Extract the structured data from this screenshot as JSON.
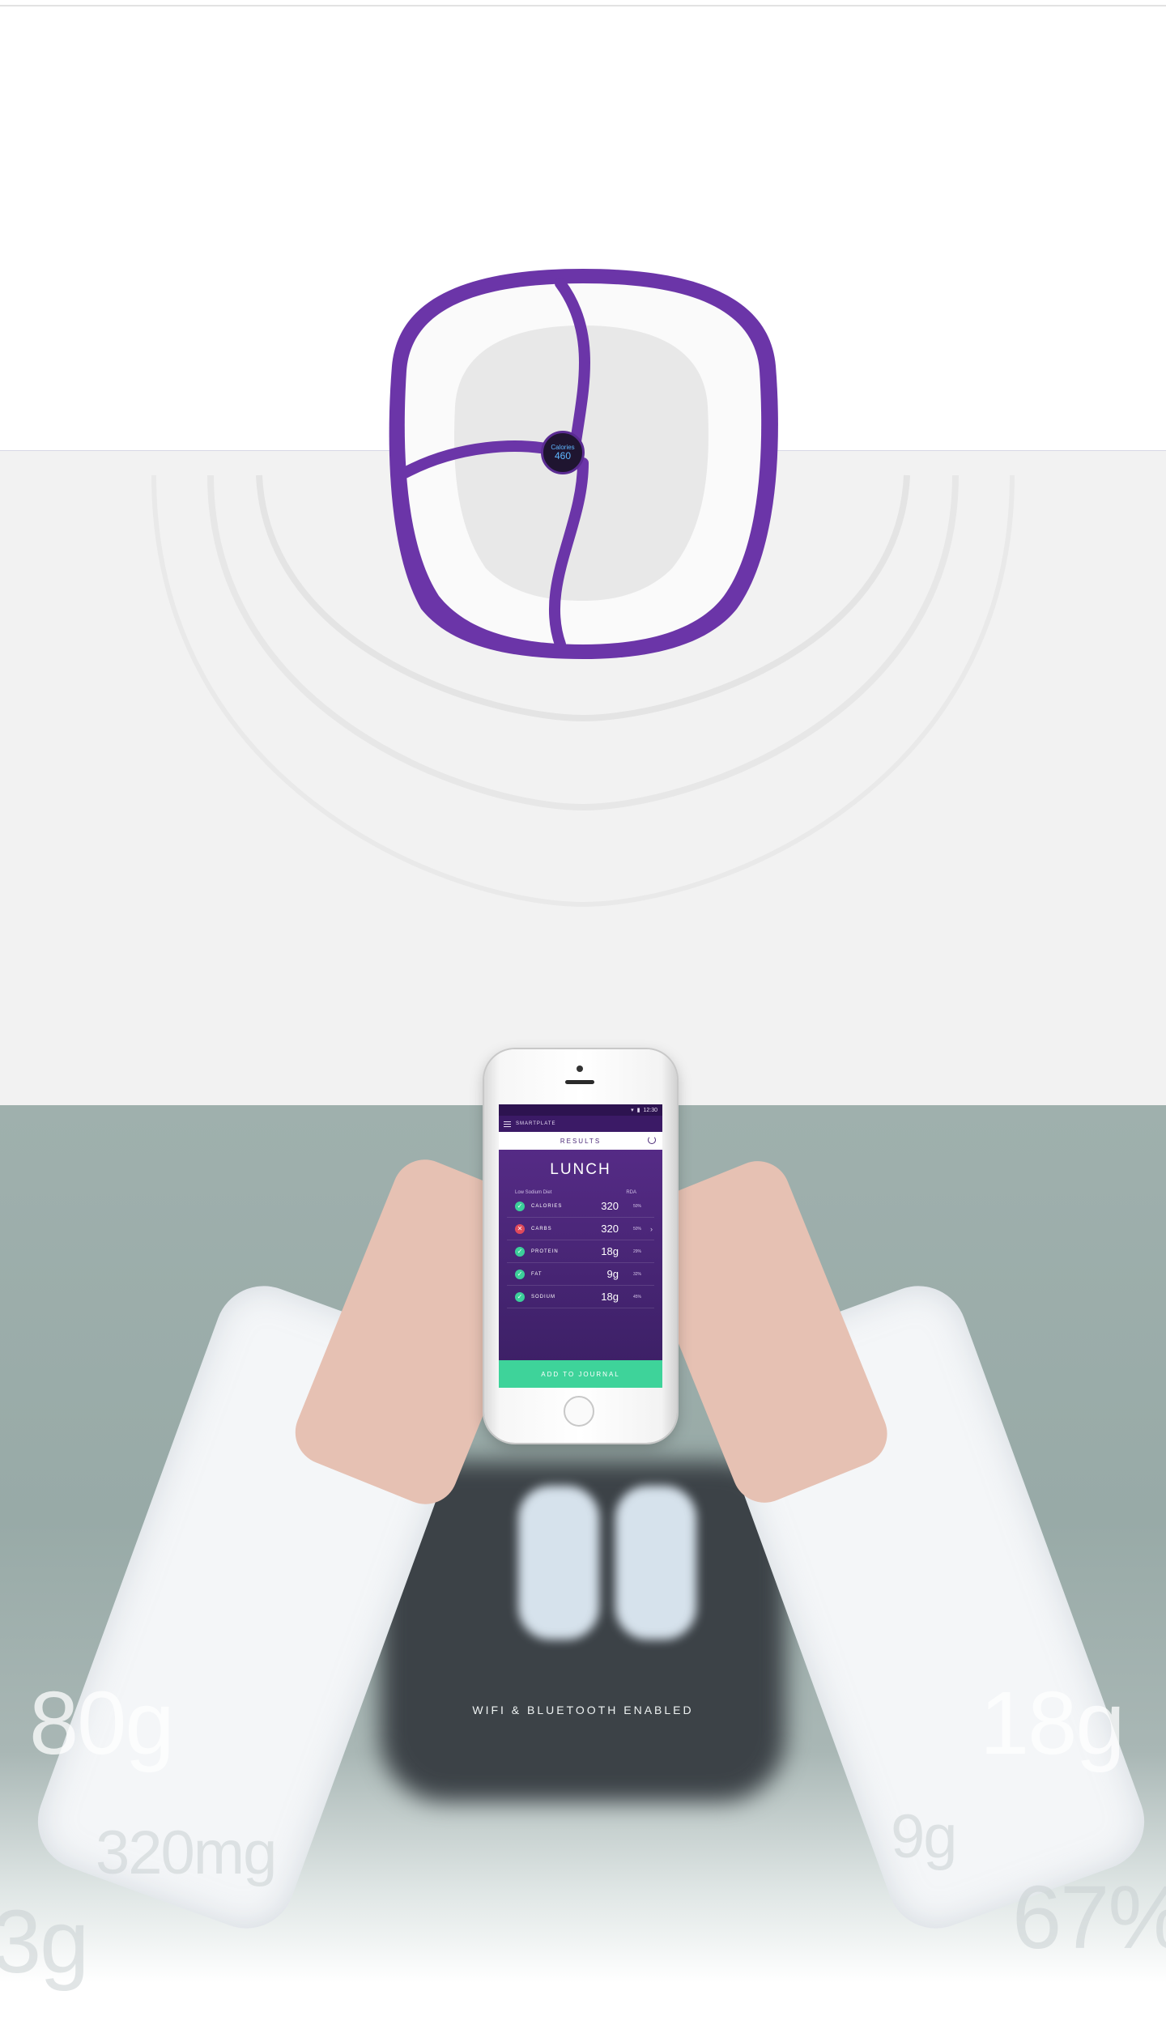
{
  "plate": {
    "calories_label": "Calories",
    "calories_value": "460",
    "rim_color": "#6b35a8"
  },
  "app": {
    "status_time": "12:30",
    "brand": "SMARTPLATE",
    "screen_title": "RESULTS",
    "meal": "LUNCH",
    "diet_label": "Low Sodium Diet",
    "rda_label": "RDA",
    "nutrients": [
      {
        "name": "CALORIES",
        "amount": "320",
        "pct": "50%",
        "ok": true
      },
      {
        "name": "CARBS",
        "amount": "320",
        "pct": "50%",
        "ok": false
      },
      {
        "name": "PROTEIN",
        "amount": "18g",
        "pct": "29%",
        "ok": true
      },
      {
        "name": "FAT",
        "amount": "9g",
        "pct": "32%",
        "ok": true
      },
      {
        "name": "SODIUM",
        "amount": "18g",
        "pct": "45%",
        "ok": true
      }
    ],
    "cta": "ADD TO JOURNAL",
    "accent": "#3ed39a",
    "header_purple": "#5a2d8c"
  },
  "feature_text": "WIFI & BLUETOOTH ENABLED",
  "background_numbers": {
    "left_top": "80g",
    "left_mid": "320mg",
    "left_bottom": "3g",
    "right_top": "18g",
    "right_mid": "9g",
    "right_bottom": "67%"
  },
  "icons": [
    "menu-icon",
    "refresh-icon",
    "check-icon",
    "cross-icon",
    "chevron-right-icon",
    "wifi-icon",
    "battery-icon"
  ]
}
